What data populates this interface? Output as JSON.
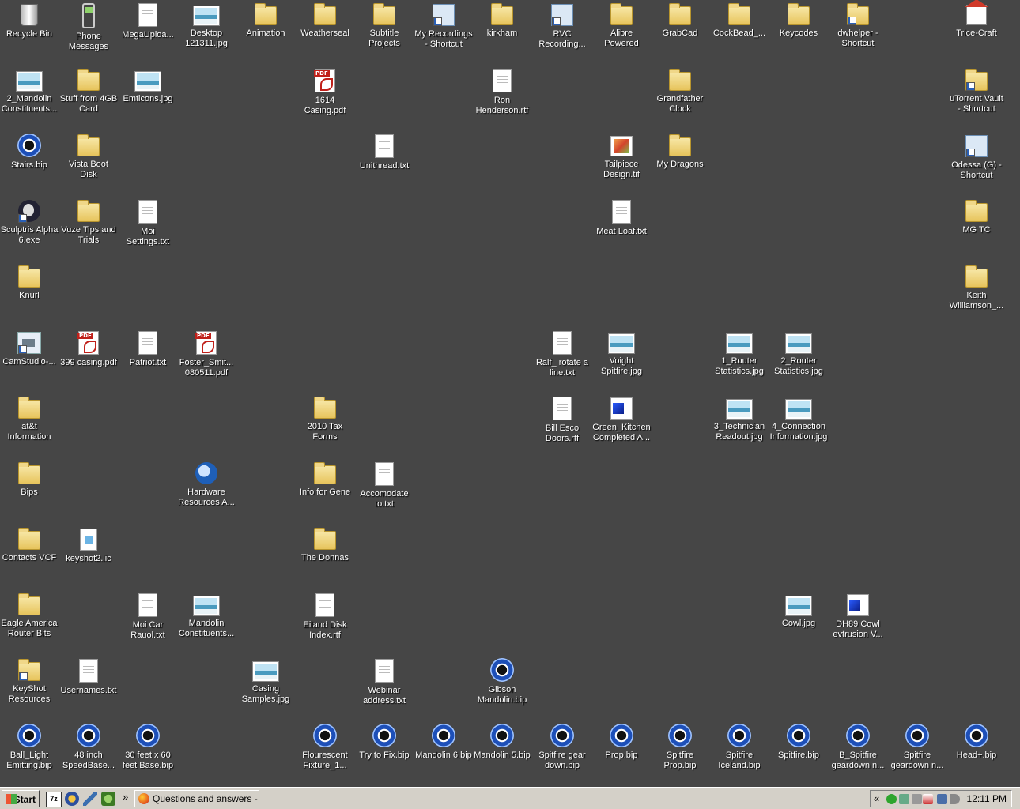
{
  "desktop": {
    "icons": [
      {
        "label": "Recycle Bin",
        "icon": "recycle-bin"
      },
      {
        "label": "Phone Messages",
        "icon": "phone"
      },
      {
        "label": "MegaUploa...",
        "icon": "text-file"
      },
      {
        "label": "Desktop 121311.jpg",
        "icon": "image-file"
      },
      {
        "label": "Animation",
        "icon": "folder"
      },
      {
        "label": "Weatherseal",
        "icon": "folder"
      },
      {
        "label": "Subtitle Projects",
        "icon": "folder"
      },
      {
        "label": "My Recordings - Shortcut",
        "icon": "shortcut"
      },
      {
        "label": "kirkham",
        "icon": "folder"
      },
      {
        "label": "RVC Recording...",
        "icon": "shortcut"
      },
      {
        "label": "Alibre Powered",
        "icon": "folder"
      },
      {
        "label": "GrabCad",
        "icon": "folder"
      },
      {
        "label": "CockBead_...",
        "icon": "folder"
      },
      {
        "label": "Keycodes",
        "icon": "folder"
      },
      {
        "label": "dwhelper - Shortcut",
        "icon": "folder-shortcut"
      },
      {
        "label": "Trice-Craft",
        "icon": "house"
      },
      {
        "label": "2_Mandolin Constituents...",
        "icon": "image-file"
      },
      {
        "label": "Stuff from 4GB Card",
        "icon": "folder"
      },
      {
        "label": "Emticons.jpg",
        "icon": "image-file"
      },
      {
        "label": "1614 Casing.pdf",
        "icon": "pdf-file"
      },
      {
        "label": "Ron Henderson.rtf",
        "icon": "rtf-file"
      },
      {
        "label": "Grandfather Clock",
        "icon": "folder"
      },
      {
        "label": "uTorrent Vault - Shortcut",
        "icon": "folder-shortcut"
      },
      {
        "label": "Stairs.bip",
        "icon": "bip-file"
      },
      {
        "label": "Vista Boot Disk",
        "icon": "folder"
      },
      {
        "label": "Unithread.txt",
        "icon": "text-file"
      },
      {
        "label": "Tailpiece Design.tif",
        "icon": "tif-file"
      },
      {
        "label": "My Dragons",
        "icon": "folder"
      },
      {
        "label": "Odessa (G) - Shortcut",
        "icon": "drive-shortcut"
      },
      {
        "label": "Sculptris Alpha 6.exe",
        "icon": "exe-file"
      },
      {
        "label": "Vuze Tips and Trials",
        "icon": "folder"
      },
      {
        "label": "Moi Settings.txt",
        "icon": "text-file"
      },
      {
        "label": "Meat Loaf.txt",
        "icon": "text-file"
      },
      {
        "label": "MG TC",
        "icon": "folder"
      },
      {
        "label": "Knurl",
        "icon": "folder"
      },
      {
        "label": "Keith Williamson_...",
        "icon": "folder"
      },
      {
        "label": "CamStudio-...",
        "icon": "camstudio-shortcut"
      },
      {
        "label": "399 casing.pdf",
        "icon": "pdf-file"
      },
      {
        "label": "Patriot.txt",
        "icon": "text-file"
      },
      {
        "label": "Foster_Smit... 080511.pdf",
        "icon": "pdf-file"
      },
      {
        "label": "Ralf_ rotate a line.txt",
        "icon": "text-file"
      },
      {
        "label": "Voight Spitfire.jpg",
        "icon": "image-file"
      },
      {
        "label": "1_Router Statistics.jpg",
        "icon": "image-file"
      },
      {
        "label": "2_Router Statistics.jpg",
        "icon": "image-file"
      },
      {
        "label": "at&t Information",
        "icon": "folder"
      },
      {
        "label": "2010 Tax Forms",
        "icon": "folder"
      },
      {
        "label": "Bill Esco Doors.rtf",
        "icon": "rtf-file"
      },
      {
        "label": "Green_Kitchen Completed A...",
        "icon": "3d-file"
      },
      {
        "label": "3_Technician Readout.jpg",
        "icon": "image-file"
      },
      {
        "label": "4_Connection Information.jpg",
        "icon": "image-file"
      },
      {
        "label": "Bips",
        "icon": "folder"
      },
      {
        "label": "Hardware Resources A...",
        "icon": "thunderbird"
      },
      {
        "label": "Info for Gene",
        "icon": "folder"
      },
      {
        "label": "Accomodate to.txt",
        "icon": "text-file"
      },
      {
        "label": "Contacts VCF",
        "icon": "folder"
      },
      {
        "label": "keyshot2.lic",
        "icon": "lic-file"
      },
      {
        "label": "The Donnas",
        "icon": "folder"
      },
      {
        "label": "Eagle America Router Bits",
        "icon": "folder"
      },
      {
        "label": "Moi Car Rauol.txt",
        "icon": "text-file"
      },
      {
        "label": "Mandolin Constituents...",
        "icon": "image-file"
      },
      {
        "label": "Eiland Disk Index.rtf",
        "icon": "rtf-file"
      },
      {
        "label": "Cowl.jpg",
        "icon": "image-file"
      },
      {
        "label": "DH89 Cowl evtrusion V...",
        "icon": "3d-file"
      },
      {
        "label": "KeyShot Resources",
        "icon": "folder-shortcut"
      },
      {
        "label": "Usernames.txt",
        "icon": "text-file"
      },
      {
        "label": "Casing Samples.jpg",
        "icon": "image-file"
      },
      {
        "label": "Webinar address.txt",
        "icon": "text-file"
      },
      {
        "label": "Gibson Mandolin.bip",
        "icon": "bip-file"
      },
      {
        "label": "Ball_Light Emitting.bip",
        "icon": "bip-file"
      },
      {
        "label": "48 inch SpeedBase...",
        "icon": "bip-file"
      },
      {
        "label": "30 feet x 60 feet Base.bip",
        "icon": "bip-file"
      },
      {
        "label": "Flourescent Fixture_1...",
        "icon": "bip-file"
      },
      {
        "label": "Try to Fix.bip",
        "icon": "bip-file"
      },
      {
        "label": "Mandolin 6.bip",
        "icon": "bip-file"
      },
      {
        "label": "Mandolin 5.bip",
        "icon": "bip-file"
      },
      {
        "label": "Spitfire gear down.bip",
        "icon": "bip-file"
      },
      {
        "label": "Prop.bip",
        "icon": "bip-file"
      },
      {
        "label": "Spitfire Prop.bip",
        "icon": "bip-file"
      },
      {
        "label": "Spitfire Iceland.bip",
        "icon": "bip-file"
      },
      {
        "label": "Spitfire.bip",
        "icon": "bip-file"
      },
      {
        "label": "B_Spitfire geardown n...",
        "icon": "bip-file"
      },
      {
        "label": "Spitfire geardown n...",
        "icon": "bip-file"
      },
      {
        "label": "Head+.bip",
        "icon": "bip-file"
      }
    ]
  },
  "taskbar": {
    "start_label": "Start",
    "quick_launch": [
      "7z-icon",
      "star-icon",
      "pen-icon",
      "app-icon"
    ],
    "chevron": "»",
    "task_label": "Questions and answers - ...",
    "tray_chevron": "«",
    "clock": "12:11 PM"
  }
}
